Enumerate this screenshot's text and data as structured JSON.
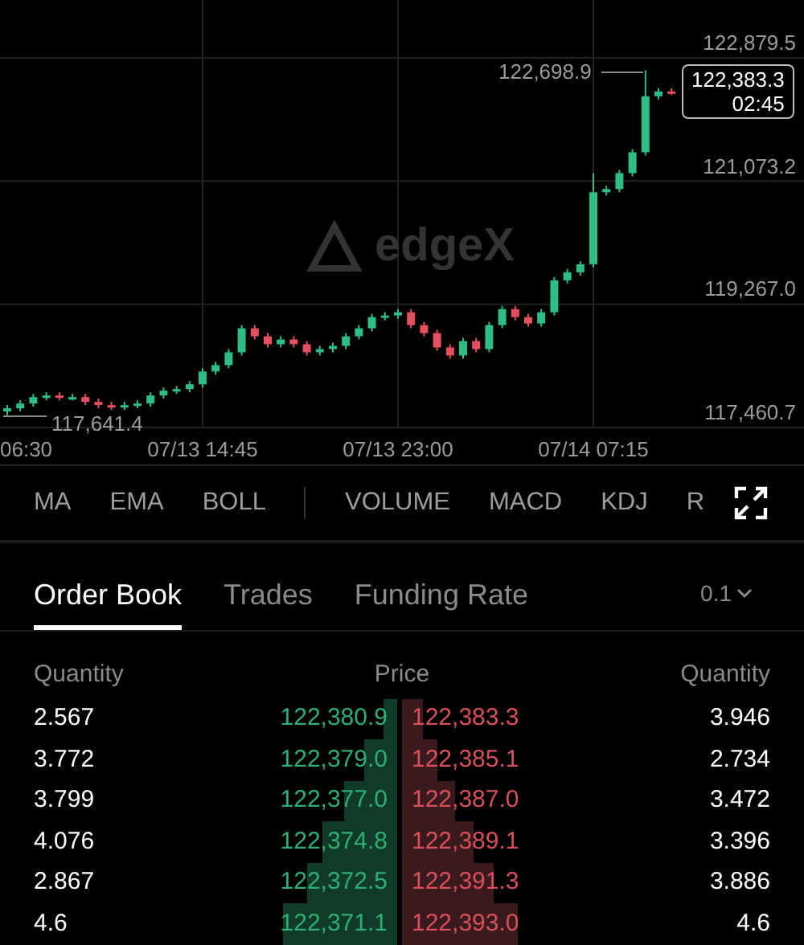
{
  "chart": {
    "watermark": "edgeX",
    "chart_data": {
      "type": "candlestick",
      "yticks": [
        {
          "value": 122879.5,
          "label": "122,879.5"
        },
        {
          "value": 121073.2,
          "label": "121,073.2"
        },
        {
          "value": 119267.0,
          "label": "119,267.0"
        },
        {
          "value": 117460.7,
          "label": "117,460.7"
        }
      ],
      "ylim": [
        117460.7,
        123727.6
      ],
      "grid": true,
      "ohlc": [
        [
          117695.3,
          117789.2,
          117641.4,
          117742.2
        ],
        [
          117742.2,
          117859.6,
          117695.2,
          117812.6
        ],
        [
          117812.6,
          117953.4,
          117765.6,
          117906.4
        ],
        [
          117906.4,
          117976.9,
          117859.4,
          117929.9
        ],
        [
          117929.9,
          117976.9,
          117859.4,
          117906.4
        ],
        [
          117906.4,
          117953.4,
          117859.4,
          117906.4
        ],
        [
          117906.4,
          117953.4,
          117789.0,
          117836.0
        ],
        [
          117836.0,
          117883.0,
          117742.1,
          117789.1
        ],
        [
          117789.1,
          117836.1,
          117718.7,
          117765.7
        ],
        [
          117765.7,
          117836.1,
          117718.7,
          117789.1
        ],
        [
          117789.1,
          117859.6,
          117742.1,
          117812.6
        ],
        [
          117812.6,
          117976.9,
          117765.6,
          117929.9
        ],
        [
          117929.9,
          118047.2,
          117882.9,
          118000.2
        ],
        [
          118000.2,
          118070.7,
          117953.2,
          118023.7
        ],
        [
          118023.7,
          118141.1,
          117976.7,
          118094.1
        ],
        [
          118094.1,
          118328.7,
          118047.1,
          118281.7
        ],
        [
          118281.7,
          118422.6,
          118234.7,
          118375.6
        ],
        [
          118375.6,
          118610.2,
          118328.6,
          118563.2
        ],
        [
          118563.2,
          118962.1,
          118516.2,
          118915.1
        ],
        [
          118915.1,
          118962.1,
          118750.8,
          118797.8
        ],
        [
          118797.8,
          118844.8,
          118633.5,
          118680.5
        ],
        [
          118680.5,
          118797.9,
          118633.5,
          118750.9
        ],
        [
          118750.9,
          118797.9,
          118633.5,
          118680.5
        ],
        [
          118680.5,
          118727.5,
          118516.2,
          118563.2
        ],
        [
          118563.2,
          118657.1,
          118516.2,
          118610.1
        ],
        [
          118610.1,
          118704.1,
          118563.1,
          118657.1
        ],
        [
          118657.1,
          118844.8,
          118610.1,
          118797.8
        ],
        [
          118797.8,
          118962.1,
          118750.8,
          118915.1
        ],
        [
          118915.1,
          119126.3,
          118868.1,
          119079.3
        ],
        [
          119079.3,
          119149.8,
          119032.3,
          119102.8
        ],
        [
          119102.8,
          119196.7,
          119055.8,
          119149.7
        ],
        [
          119149.7,
          119196.7,
          118915.0,
          118962.0
        ],
        [
          118962.0,
          119009.0,
          118797.7,
          118844.7
        ],
        [
          118844.7,
          118891.7,
          118586.6,
          118633.6
        ],
        [
          118633.6,
          118680.6,
          118469.3,
          118516.3
        ],
        [
          118516.3,
          118774.4,
          118469.3,
          118727.4
        ],
        [
          118727.4,
          118774.4,
          118563.1,
          118610.1
        ],
        [
          118610.1,
          119009.0,
          118563.1,
          118962.0
        ],
        [
          118962.0,
          119243.6,
          118915.0,
          119196.6
        ],
        [
          119196.6,
          119243.6,
          119032.3,
          119079.3
        ],
        [
          119079.3,
          119126.3,
          118938.5,
          118985.5
        ],
        [
          118985.5,
          119196.7,
          118938.5,
          119149.7
        ],
        [
          119149.7,
          119665.8,
          119102.7,
          119618.8
        ],
        [
          119618.8,
          119783.1,
          119571.8,
          119736.1
        ],
        [
          119736.1,
          119900.4,
          119689.1,
          119853.4
        ],
        [
          119853.4,
          121190.0,
          119806.4,
          120909.0
        ],
        [
          120909.0,
          121002.9,
          120862.0,
          120955.9
        ],
        [
          120955.9,
          121237.5,
          120908.9,
          121190.5
        ],
        [
          121190.5,
          121542.5,
          121143.5,
          121495.5
        ],
        [
          121495.5,
          122698.9,
          121448.5,
          122316.5
        ],
        [
          122316.5,
          122433.9,
          122269.5,
          122386.9
        ],
        [
          122386.9,
          122433.9,
          122336.3,
          122383.3
        ]
      ]
    },
    "time_axis": [
      "06:30",
      "07/13 14:45",
      "07/13 23:00",
      "07/14 07:15"
    ],
    "high_marker": "122,698.9",
    "low_marker": "117,641.4",
    "last_price": "122,383.3",
    "countdown": "02:45"
  },
  "indicator_groups": [
    [
      "MA",
      "EMA",
      "BOLL"
    ],
    [
      "VOLUME",
      "MACD",
      "KDJ",
      "R"
    ]
  ],
  "tabs": [
    {
      "label": "Order Book",
      "selected": true
    },
    {
      "label": "Trades",
      "selected": false
    },
    {
      "label": "Funding Rate",
      "selected": false
    }
  ],
  "precision": "0.1",
  "order_book": {
    "columns": [
      "Quantity",
      "Price",
      "Quantity"
    ],
    "rows": [
      {
        "bid": {
          "qty": "2.567",
          "price": "122,380.9"
        },
        "ask": {
          "price": "122,383.3",
          "qty": "3.946"
        }
      },
      {
        "bid": {
          "qty": "3.772",
          "price": "122,379.0"
        },
        "ask": {
          "price": "122,385.1",
          "qty": "2.734"
        }
      },
      {
        "bid": {
          "qty": "3.799",
          "price": "122,377.0"
        },
        "ask": {
          "price": "122,387.0",
          "qty": "3.472"
        }
      },
      {
        "bid": {
          "qty": "4.076",
          "price": "122,374.8"
        },
        "ask": {
          "price": "122,389.1",
          "qty": "3.396"
        }
      },
      {
        "bid": {
          "qty": "2.867",
          "price": "122,372.5"
        },
        "ask": {
          "price": "122,391.3",
          "qty": "3.886"
        }
      },
      {
        "bid": {
          "qty": "4.6",
          "price": "122,371.1"
        },
        "ask": {
          "price": "122,393.0",
          "qty": "4.6"
        }
      }
    ]
  }
}
